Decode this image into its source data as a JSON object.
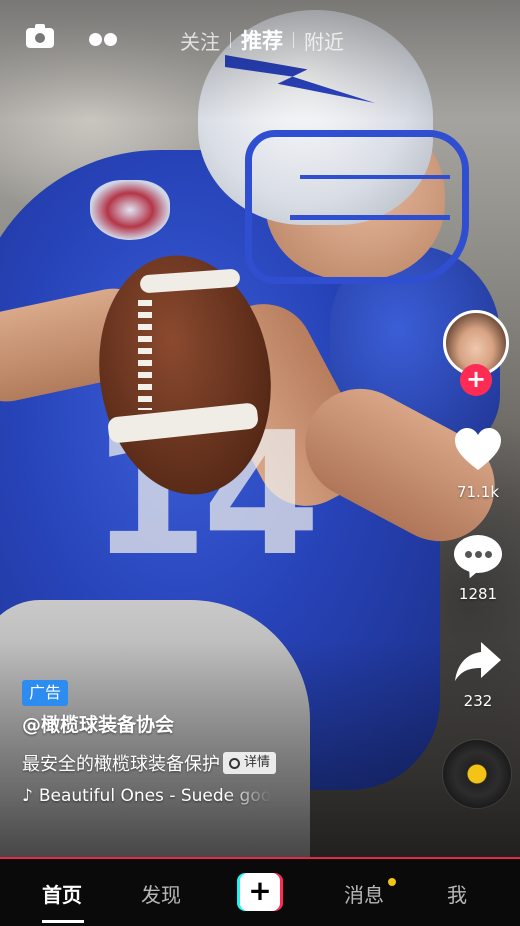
{
  "top": {
    "tabs": [
      {
        "label": "关注",
        "active": false
      },
      {
        "label": "推荐",
        "active": true
      },
      {
        "label": "附近",
        "active": false
      }
    ]
  },
  "rail": {
    "likes": "71.1k",
    "comments": "1281",
    "shares": "232"
  },
  "video": {
    "ad_label": "广告",
    "author": "@橄榄球装备协会",
    "description": "最安全的橄榄球装备保护",
    "detail_label": "详情",
    "music": "Beautiful Ones - Suede goo",
    "music_icon": "♪"
  },
  "nav": {
    "items": [
      {
        "label": "首页",
        "active": true
      },
      {
        "label": "发现",
        "active": false
      },
      {
        "label": "消息",
        "active": false
      },
      {
        "label": "我",
        "active": false
      }
    ],
    "create_icon": "+"
  },
  "colors": {
    "accent": "#fe2c55",
    "cyan": "#25f4ee",
    "ad_badge": "#2d8cf0",
    "notification_dot": "#f4c316"
  }
}
